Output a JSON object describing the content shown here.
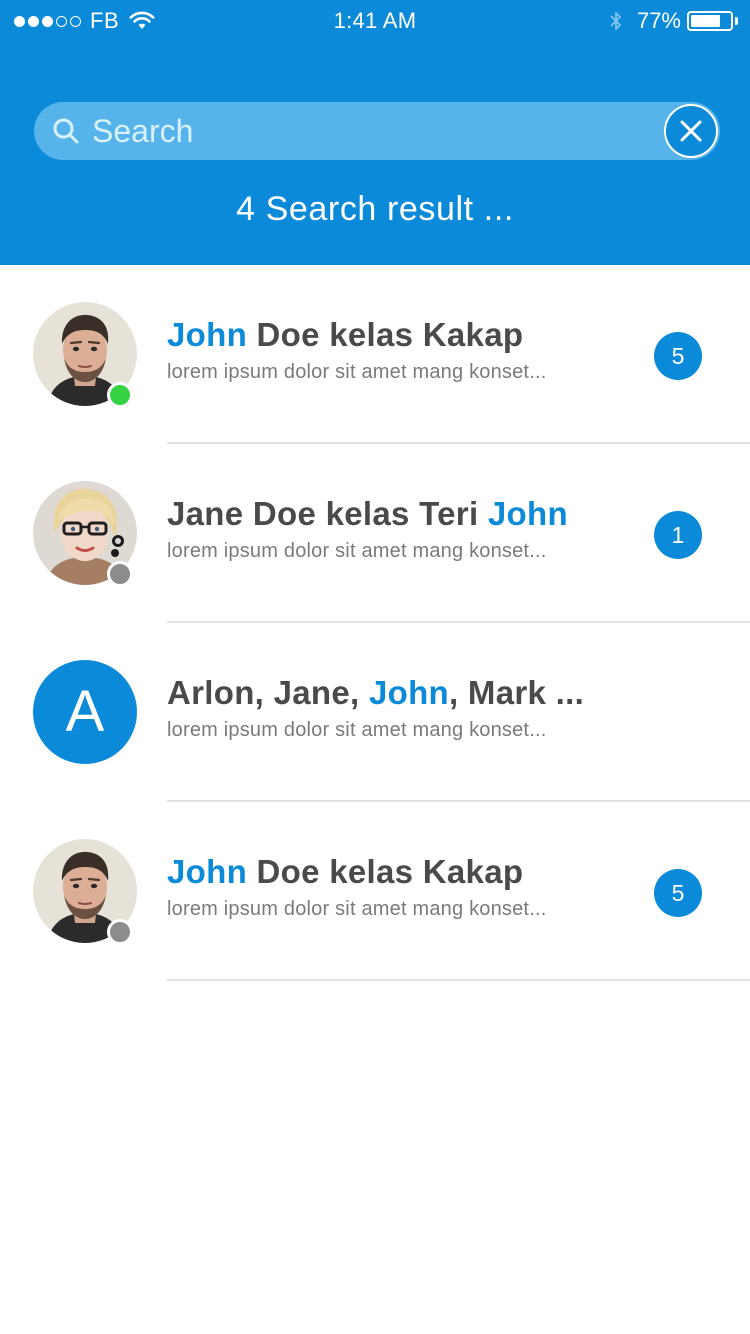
{
  "status_bar": {
    "carrier": "FB",
    "signal_bars_filled": 3,
    "signal_bars_total": 5,
    "time": "1:41 AM",
    "battery_percent": "77%",
    "battery_level": 0.77,
    "icons": [
      "wifi-icon",
      "bluetooth-icon",
      "battery-icon"
    ]
  },
  "search": {
    "placeholder": "Search",
    "value": "",
    "icon": "search-icon",
    "clear_icon": "close-icon"
  },
  "result_count": "4 Search result ...",
  "results": [
    {
      "title_parts": [
        "John",
        " Doe kelas Kakap"
      ],
      "highlight": [
        true,
        false
      ],
      "preview": "lorem ipsum dolor sit amet mang konset...",
      "badge": "5",
      "presence": "online",
      "avatar": "man-photo"
    },
    {
      "title_parts": [
        "Jane Doe kelas Teri ",
        "John"
      ],
      "highlight": [
        false,
        true
      ],
      "preview": "lorem ipsum dolor sit amet mang konset...",
      "badge": "1",
      "presence": "offline",
      "avatar": "woman-photo"
    },
    {
      "title_parts": [
        "Arlon, Jane, ",
        "John",
        ", Mark ..."
      ],
      "highlight": [
        false,
        true,
        false
      ],
      "preview": "lorem ipsum dolor sit amet mang konset...",
      "avatar_letter": "A",
      "avatar": "letter"
    },
    {
      "title_parts": [
        "John",
        " Doe kelas Kakap"
      ],
      "highlight": [
        true,
        false
      ],
      "preview": "lorem ipsum dolor sit amet mang konset...",
      "badge": "5",
      "presence": "offline",
      "avatar": "man-photo"
    }
  ],
  "colors": {
    "primary": "#0a8ad8",
    "search_field": "#56b4ea",
    "title_text": "#4a4a4a",
    "preview_text": "#7a7a7a",
    "online": "#36d246",
    "offline": "#8c8c8c"
  }
}
